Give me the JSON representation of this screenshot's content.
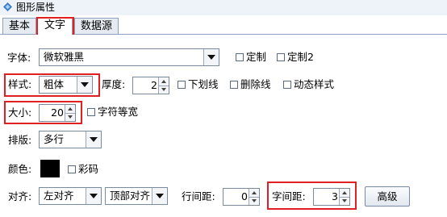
{
  "window": {
    "title": "图形属性"
  },
  "tabs": [
    {
      "label": "基本"
    },
    {
      "label": "文字",
      "active": true
    },
    {
      "label": "数据源"
    }
  ],
  "font": {
    "label": "字体:",
    "value": "微软雅黑",
    "custom_label": "定制",
    "custom2_label": "定制2"
  },
  "style": {
    "label": "样式:",
    "value": "粗体",
    "thickness_label": "厚度:",
    "thickness_value": "2",
    "underline_label": "下划线",
    "strikethrough_label": "删除线",
    "dynamic_style_label": "动态样式"
  },
  "size": {
    "label": "大小:",
    "value": "20",
    "equal_width_label": "字符等宽"
  },
  "layout": {
    "label": "排版:",
    "value": "多行"
  },
  "color": {
    "label": "颜色:",
    "swatch": "#000000",
    "colorful_label": "彩码"
  },
  "align": {
    "label": "对齐:",
    "h_value": "左对齐",
    "v_value": "顶部对齐",
    "line_spacing_label": "行间距:",
    "line_spacing_value": "0",
    "char_spacing_label": "字间距:",
    "char_spacing_value": "3",
    "advanced_label": "高级"
  },
  "colors": {
    "highlight": "#e02020",
    "tab_border": "#8aa1bf",
    "titlebar": "#eef3fa"
  }
}
